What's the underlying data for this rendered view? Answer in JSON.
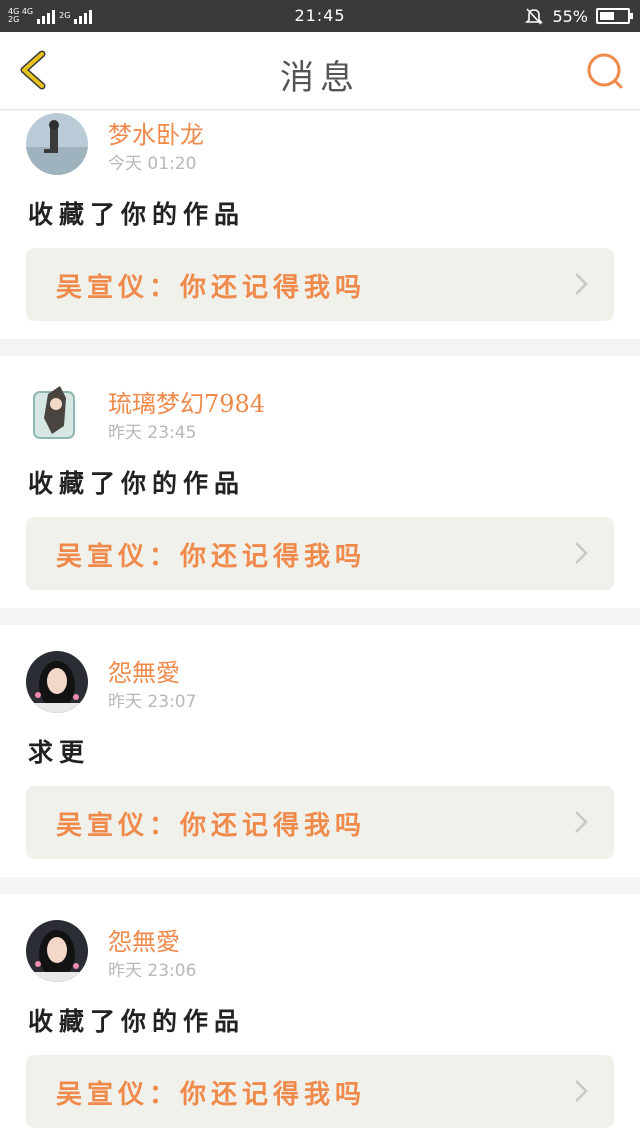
{
  "status_bar": {
    "network_top": "4G 4G",
    "network_bottom": "2G",
    "network_extra": "2G",
    "time": "21:45",
    "battery": "55%",
    "battery_level": 0.55,
    "icons": [
      "signal-icon",
      "mute-bell-icon",
      "battery-icon"
    ]
  },
  "nav": {
    "title": "消息",
    "back_icon": "back-chevron-icon",
    "search_icon": "search-icon"
  },
  "colors": {
    "accent": "#f08a4b",
    "back_icon": "#e6c21a",
    "work_bg": "#f1f1ec"
  },
  "messages": [
    {
      "user": "梦水卧龙",
      "time": "今天 01:20",
      "content": "收藏了你的作品",
      "work": "吴宣仪：你还记得我吗"
    },
    {
      "user": "琉璃梦幻7984",
      "time": "昨天 23:45",
      "content": "收藏了你的作品",
      "work": "吴宣仪：你还记得我吗"
    },
    {
      "user": "怨無愛",
      "time": "昨天 23:07",
      "content": "求更",
      "work": "吴宣仪：你还记得我吗"
    },
    {
      "user": "怨無愛",
      "time": "昨天 23:06",
      "content": "收藏了你的作品",
      "work": "吴宣仪：你还记得我吗"
    }
  ]
}
